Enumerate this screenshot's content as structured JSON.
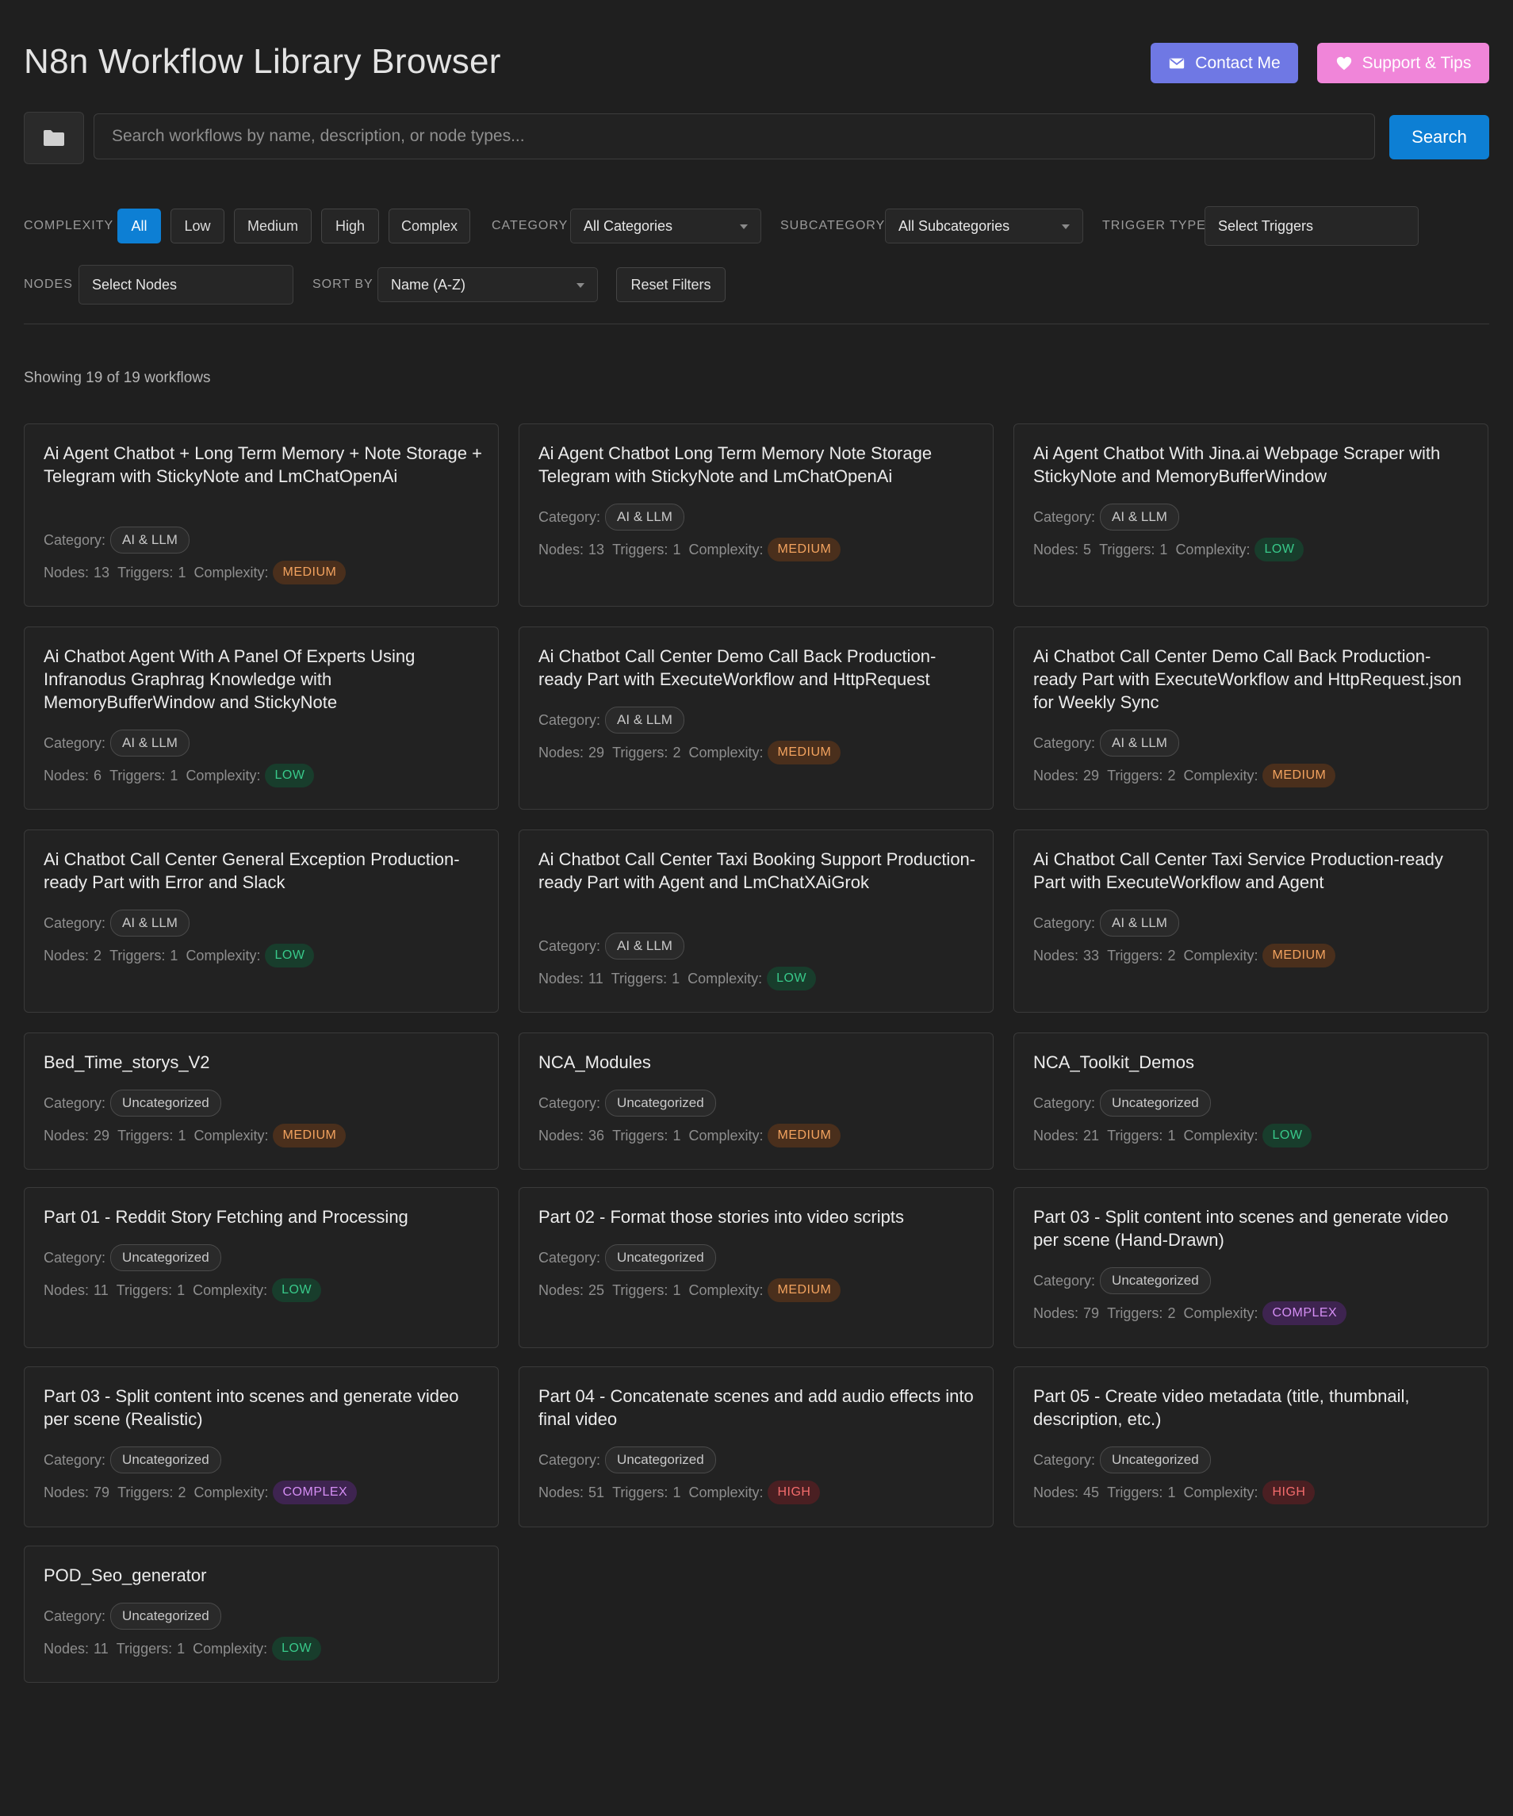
{
  "header": {
    "title": "N8n Workflow Library Browser",
    "contact_label": "Contact Me",
    "support_label": "Support & Tips"
  },
  "search": {
    "placeholder": "Search workflows by name, description, or node types...",
    "button_label": "Search"
  },
  "filters": {
    "complexity_label": "COMPLEXITY",
    "complexity_options": [
      "All",
      "Low",
      "Medium",
      "High",
      "Complex"
    ],
    "complexity_selected": "All",
    "category_label": "CATEGORY",
    "category_value": "All Categories",
    "subcategory_label": "SUBCATEGORY",
    "subcategory_value": "All Subcategories",
    "trigger_label": "TRIGGER TYPE",
    "trigger_value": "Select Triggers",
    "nodes_label": "NODES",
    "nodes_value": "Select Nodes",
    "sort_label": "SORT BY",
    "sort_value": "Name (A-Z)",
    "reset_label": "Reset Filters"
  },
  "results": {
    "count_text": "Showing 19 of 19 workflows"
  },
  "card_labels": {
    "category": "Category:",
    "nodes": "Nodes:",
    "triggers": "Triggers:",
    "complexity": "Complexity:"
  },
  "workflows": [
    {
      "title": "Ai Agent Chatbot + Long Term Memory + Note Storage + Telegram with StickyNote and LmChatOpenAi",
      "category": "AI & LLM",
      "nodes": "13",
      "triggers": "1",
      "complexity": "MEDIUM"
    },
    {
      "title": "Ai Agent Chatbot Long Term Memory Note Storage Telegram with StickyNote and LmChatOpenAi",
      "category": "AI & LLM",
      "nodes": "13",
      "triggers": "1",
      "complexity": "MEDIUM"
    },
    {
      "title": "Ai Agent Chatbot With Jina.ai Webpage Scraper with StickyNote and MemoryBufferWindow",
      "category": "AI & LLM",
      "nodes": "5",
      "triggers": "1",
      "complexity": "LOW"
    },
    {
      "title": "Ai Chatbot Agent With A Panel Of Experts Using Infranodus Graphrag Knowledge with MemoryBufferWindow and StickyNote",
      "category": "AI & LLM",
      "nodes": "6",
      "triggers": "1",
      "complexity": "LOW"
    },
    {
      "title": "Ai Chatbot Call Center Demo Call Back Production-ready Part with ExecuteWorkflow and HttpRequest",
      "category": "AI & LLM",
      "nodes": "29",
      "triggers": "2",
      "complexity": "MEDIUM"
    },
    {
      "title": "Ai Chatbot Call Center Demo Call Back Production-ready Part with ExecuteWorkflow and HttpRequest.json for Weekly Sync",
      "category": "AI & LLM",
      "nodes": "29",
      "triggers": "2",
      "complexity": "MEDIUM"
    },
    {
      "title": "Ai Chatbot Call Center General Exception Production-ready Part with Error and Slack",
      "category": "AI & LLM",
      "nodes": "2",
      "triggers": "1",
      "complexity": "LOW"
    },
    {
      "title": "Ai Chatbot Call Center Taxi Booking Support Production-ready Part with Agent and LmChatXAiGrok",
      "category": "AI & LLM",
      "nodes": "11",
      "triggers": "1",
      "complexity": "LOW"
    },
    {
      "title": "Ai Chatbot Call Center Taxi Service Production-ready Part with ExecuteWorkflow and Agent",
      "category": "AI & LLM",
      "nodes": "33",
      "triggers": "2",
      "complexity": "MEDIUM"
    },
    {
      "title": "Bed_Time_storys_V2",
      "category": "Uncategorized",
      "nodes": "29",
      "triggers": "1",
      "complexity": "MEDIUM"
    },
    {
      "title": "NCA_Modules",
      "category": "Uncategorized",
      "nodes": "36",
      "triggers": "1",
      "complexity": "MEDIUM"
    },
    {
      "title": "NCA_Toolkit_Demos",
      "category": "Uncategorized",
      "nodes": "21",
      "triggers": "1",
      "complexity": "LOW"
    },
    {
      "title": "Part 01 - Reddit Story Fetching and Processing",
      "category": "Uncategorized",
      "nodes": "11",
      "triggers": "1",
      "complexity": "LOW"
    },
    {
      "title": "Part 02 - Format those stories into video scripts",
      "category": "Uncategorized",
      "nodes": "25",
      "triggers": "1",
      "complexity": "MEDIUM"
    },
    {
      "title": "Part 03 - Split content into scenes and generate video per scene (Hand-Drawn)",
      "category": "Uncategorized",
      "nodes": "79",
      "triggers": "2",
      "complexity": "COMPLEX"
    },
    {
      "title": "Part 03 - Split content into scenes and generate video per scene (Realistic)",
      "category": "Uncategorized",
      "nodes": "79",
      "triggers": "2",
      "complexity": "COMPLEX"
    },
    {
      "title": "Part 04 - Concatenate scenes and add audio effects into final video",
      "category": "Uncategorized",
      "nodes": "51",
      "triggers": "1",
      "complexity": "HIGH"
    },
    {
      "title": "Part 05 - Create video metadata (title, thumbnail, description, etc.)",
      "category": "Uncategorized",
      "nodes": "45",
      "triggers": "1",
      "complexity": "HIGH"
    },
    {
      "title": "POD_Seo_generator",
      "category": "Uncategorized",
      "nodes": "11",
      "triggers": "1",
      "complexity": "LOW"
    }
  ],
  "colors": {
    "accent": "#0d7fd4",
    "contact": "#6f78e4",
    "support": "#f085d9",
    "medium": "#f3a35f",
    "low": "#38c98a",
    "complex": "#d58ef4",
    "high": "#f36c6c"
  },
  "icons": {
    "folder": "folder-icon",
    "mail": "envelope-icon",
    "heart": "heart-icon"
  }
}
